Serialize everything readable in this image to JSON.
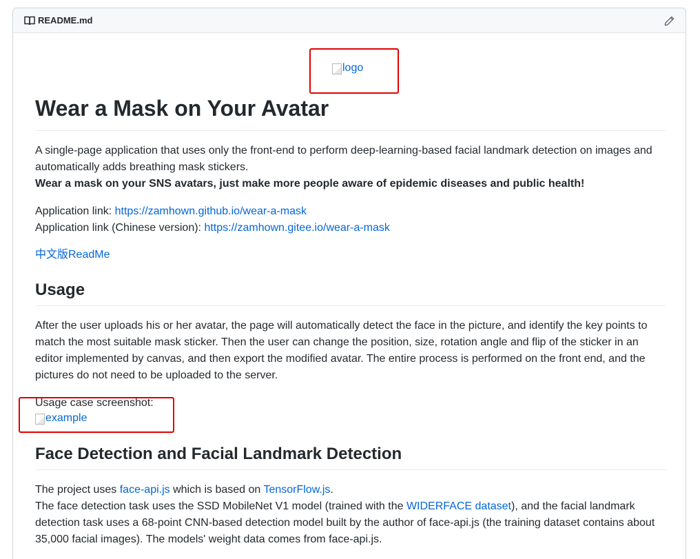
{
  "header": {
    "file_name": "README.md",
    "book_icon": "book-icon",
    "edit_icon": "pencil-icon"
  },
  "logo": {
    "alt": "logo"
  },
  "title": "Wear a Mask on Your Avatar",
  "intro": {
    "line1": "A single-page application that uses only the front-end to perform deep-learning-based facial landmark detection on images and automatically adds breathing mask stickers.",
    "line2_bold": "Wear a mask on your SNS avatars, just make more people aware of epidemic diseases and public health!"
  },
  "links": {
    "app_label": "Application link: ",
    "app_url": "https://zamhown.github.io/wear-a-mask",
    "app_cn_label": "Application link (Chinese version): ",
    "app_cn_url": "https://zamhown.gitee.io/wear-a-mask",
    "cn_readme": "中文版ReadMe"
  },
  "usage": {
    "heading": "Usage",
    "paragraph": "After the user uploads his or her avatar, the page will automatically detect the face in the picture, and identify the key points to match the most suitable mask sticker. Then the user can change the position, size, rotation angle and flip of the sticker in an editor implemented by canvas, and then export the modified avatar. The entire process is performed on the front end, and the pictures do not need to be uploaded to the server.",
    "screenshot_label": "Usage case screenshot:",
    "example_alt": "example"
  },
  "face": {
    "heading": "Face Detection and Facial Landmark Detection",
    "p1_a": "The project uses ",
    "p1_link1": "face-api.js",
    "p1_b": " which is based on ",
    "p1_link2": "TensorFlow.js",
    "p1_c": ".",
    "p2_a": "The face detection task uses the SSD MobileNet V1 model (trained with the ",
    "p2_link": "WIDERFACE dataset",
    "p2_b": "), and the facial landmark detection task uses a 68-point CNN-based detection model built by the author of face-api.js (the training dataset contains about 35,000 facial images). The models' weight data comes from face-api.js."
  },
  "colors": {
    "link": "#0366d6",
    "highlight": "#e00000",
    "text": "#24292e"
  }
}
